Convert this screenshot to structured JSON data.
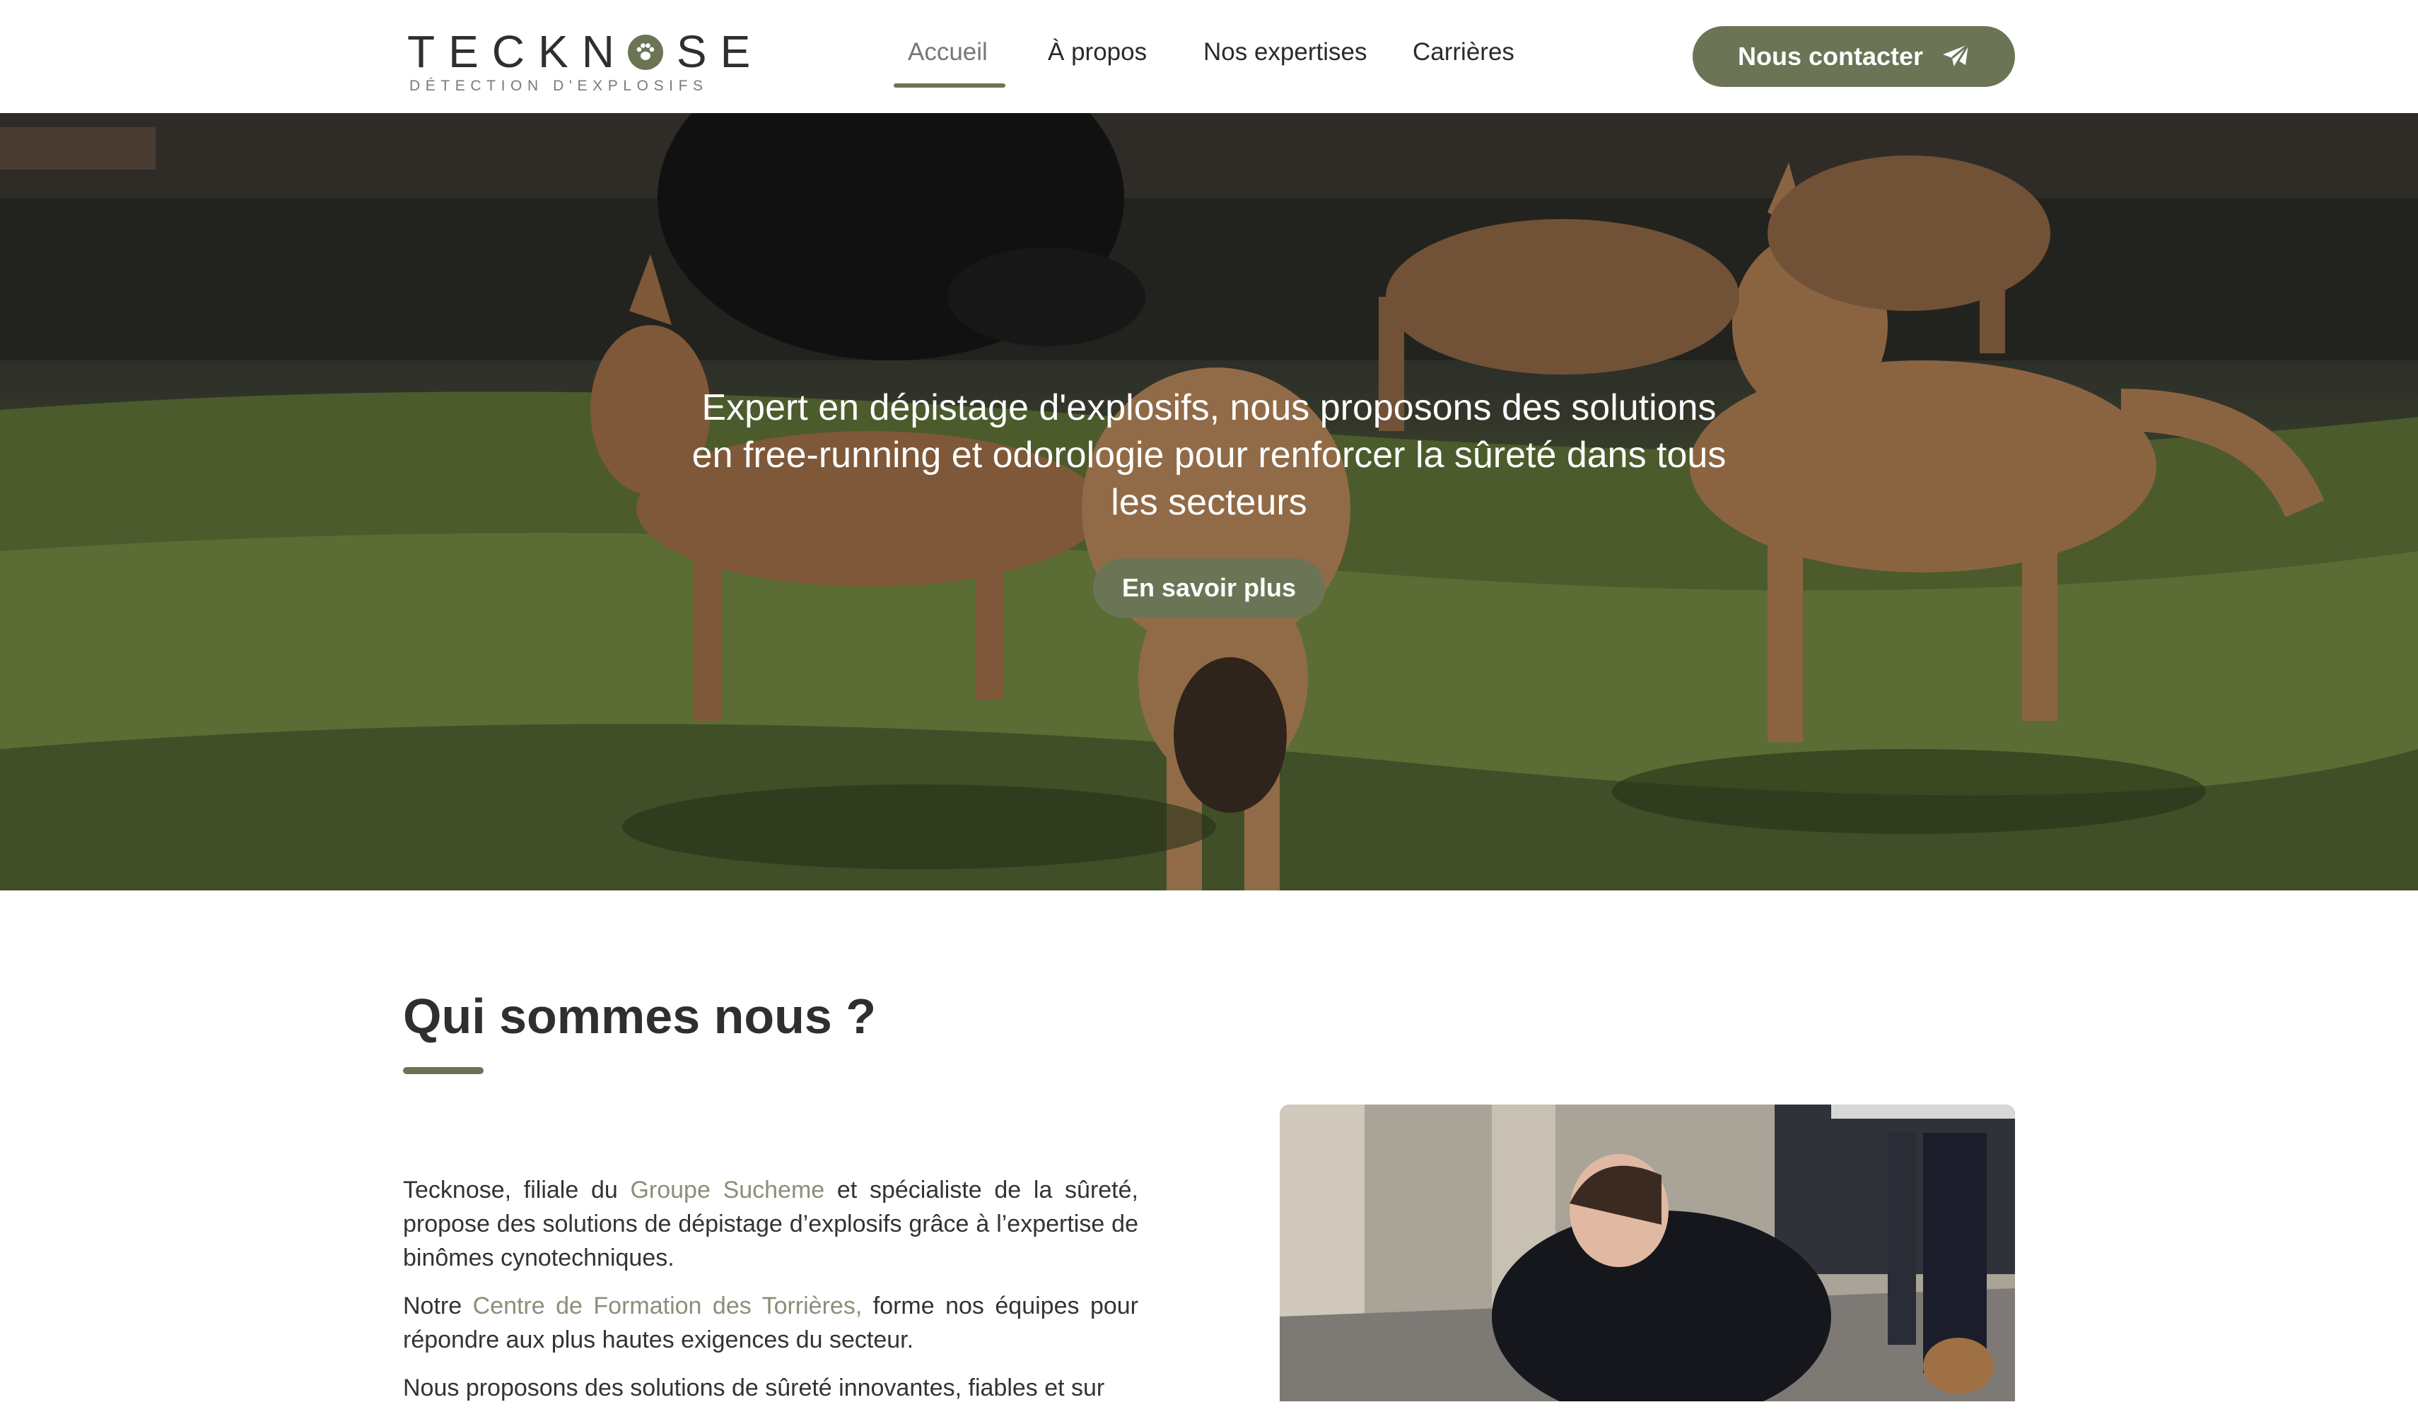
{
  "brand": {
    "name_left": "TECKN",
    "name_right": "SE",
    "tagline": "DÉTECTION D'EXPLOSIFS",
    "logo_icon": "paw-icon",
    "accent_color": "#6b7556"
  },
  "nav": {
    "items": [
      {
        "label": "Accueil",
        "active": true
      },
      {
        "label": "À propos",
        "active": false
      },
      {
        "label": "Nos expertises",
        "active": false
      },
      {
        "label": "Carrières",
        "active": false
      }
    ],
    "contact_label": "Nous contacter",
    "contact_icon": "paper-plane-icon"
  },
  "hero": {
    "text": "Expert en dépistage d'explosifs, nous proposons des solutions en free-running et odorologie pour renforcer la sûreté dans tous les secteurs",
    "cta_label": "En savoir plus"
  },
  "about": {
    "title": "Qui sommes nous ?",
    "p1_a": "Tecknose, filiale du ",
    "p1_link": "Groupe Sucheme",
    "p1_b": " et spécialiste de la sûreté, propose des solutions de dépistage d’explosifs grâce à l’expertise de binômes cynotechniques.",
    "p2_a": "Notre ",
    "p2_link": "Centre de Formation des Torrières,",
    "p2_b": " forme nos équipes pour répondre aux plus hautes exigences du secteur.",
    "p3": "Nous proposons des solutions de sûreté innovantes, fiables et sur"
  }
}
